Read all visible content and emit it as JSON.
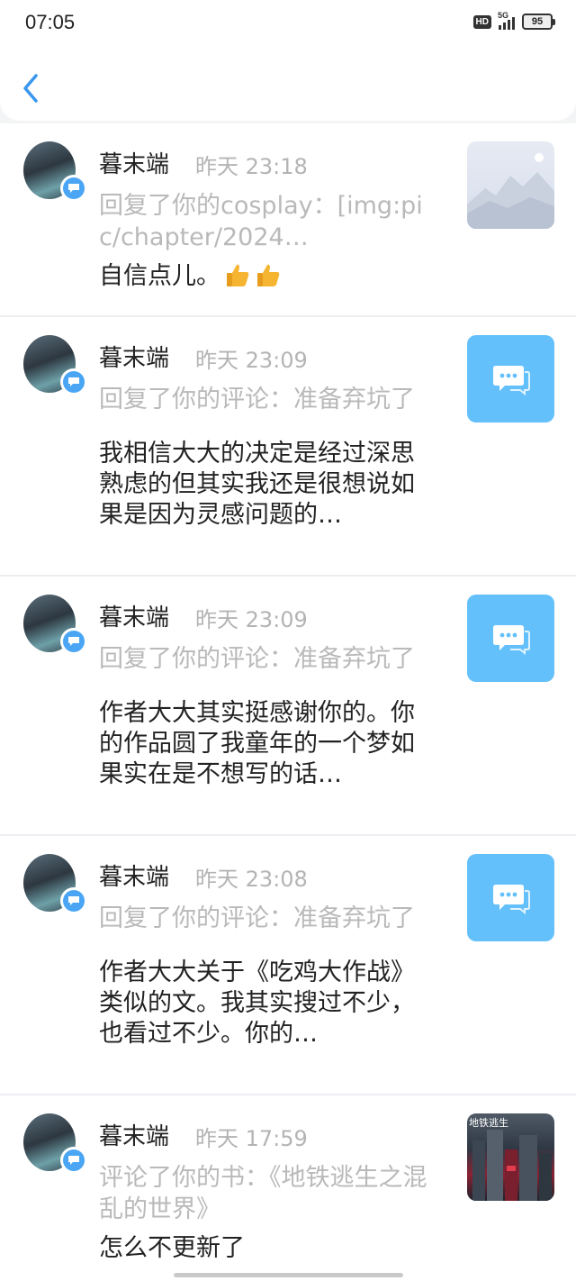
{
  "status_bar": {
    "time": "07:05",
    "hd": "HD",
    "network": "5G",
    "battery": "95"
  },
  "messages": [
    {
      "name": "暮末端",
      "time": "昨天 23:18",
      "reference": "回复了你的cosplay：[img:pic/chapter/2024…",
      "text": "自信点儿。",
      "thumbnail": "cosplay-image"
    },
    {
      "name": "暮末端",
      "time": "昨天 23:09",
      "reference": "回复了你的评论：准备弃坑了",
      "text": "我相信大大的决定是经过深思熟虑的但其实我还是很想说如果是因为灵感问题的…",
      "thumbnail": "comment-icon"
    },
    {
      "name": "暮末端",
      "time": "昨天 23:09",
      "reference": "回复了你的评论：准备弃坑了",
      "text": "作者大大其实挺感谢你的。你的作品圆了我童年的一个梦如果实在是不想写的话…",
      "thumbnail": "comment-icon"
    },
    {
      "name": "暮末端",
      "time": "昨天 23:08",
      "reference": "回复了你的评论：准备弃坑了",
      "text": "作者大大关于《吃鸡大作战》类似的文。我其实搜过不少，也看过不少。你的…",
      "thumbnail": "comment-icon"
    },
    {
      "name": "暮末端",
      "time": "昨天 17:59",
      "reference": "评论了你的书：《地铁逃生之混乱的世界》",
      "text": "怎么不更新了",
      "thumbnail": "book-cover",
      "cover_text": "地铁逃生"
    }
  ],
  "colors": {
    "accent": "#4aa6f5",
    "thumb_blue": "#64c0fb",
    "muted": "#b4b4b4"
  }
}
